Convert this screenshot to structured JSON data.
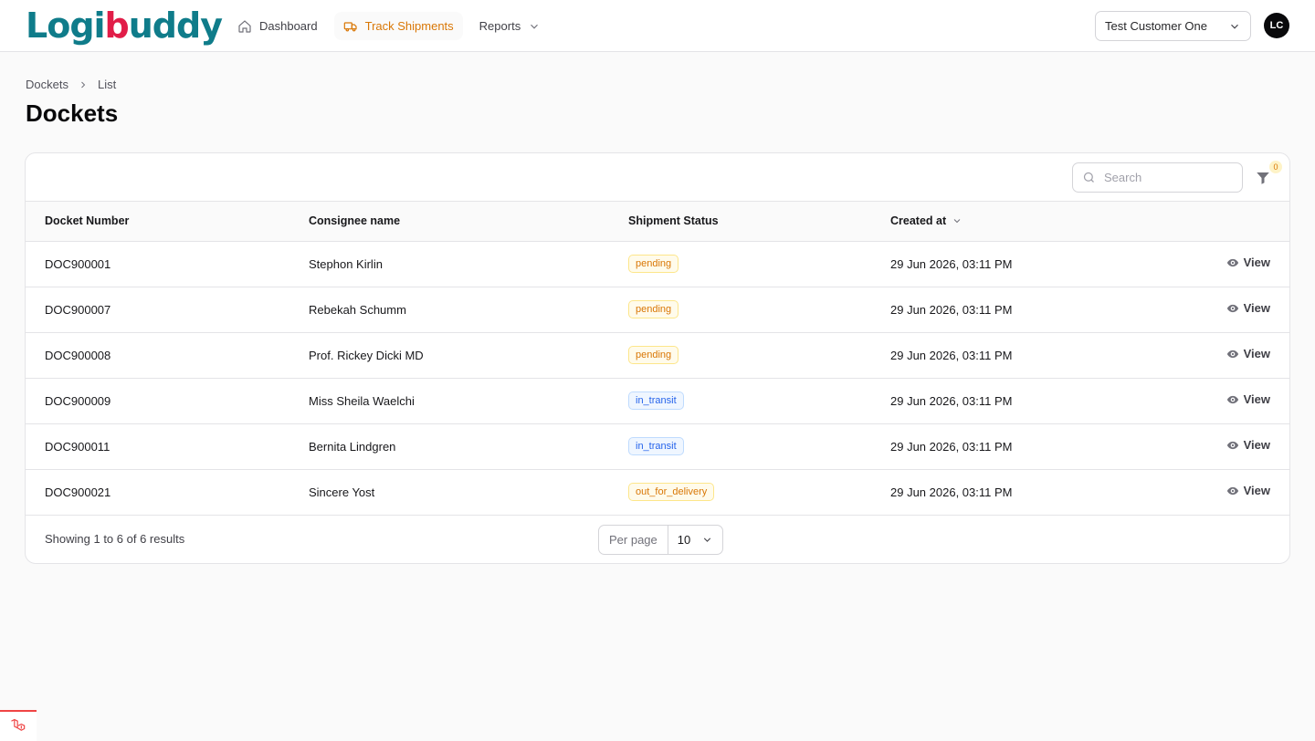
{
  "brand": {
    "name_part1": "Logi",
    "name_dot": "b",
    "name_part2": "uddy"
  },
  "nav": [
    {
      "label": "Dashboard",
      "icon": "home-icon"
    },
    {
      "label": "Track Shipments",
      "icon": "truck-icon",
      "active": true
    },
    {
      "label": "Reports",
      "icon": "chevron-down-icon"
    }
  ],
  "customer_select": {
    "value": "Test Customer One"
  },
  "user": {
    "initials": "LC"
  },
  "breadcrumb": {
    "parent": "Dockets",
    "current": "List"
  },
  "page_title": "Dockets",
  "search": {
    "placeholder": "Search"
  },
  "filter": {
    "count": "0"
  },
  "table": {
    "headers": {
      "docket_number": "Docket Number",
      "consignee_name": "Consignee name",
      "shipment_status": "Shipment Status",
      "created_at": "Created at"
    },
    "rows": [
      {
        "docket": "DOC900001",
        "consignee": "Stephon Kirlin",
        "status": "pending",
        "status_color": "warning",
        "created": "29 Jun 2026, 03:11 PM",
        "action": "View"
      },
      {
        "docket": "DOC900007",
        "consignee": "Rebekah Schumm",
        "status": "pending",
        "status_color": "warning",
        "created": "29 Jun 2026, 03:11 PM",
        "action": "View"
      },
      {
        "docket": "DOC900008",
        "consignee": "Prof. Rickey Dicki MD",
        "status": "pending",
        "status_color": "warning",
        "created": "29 Jun 2026, 03:11 PM",
        "action": "View"
      },
      {
        "docket": "DOC900009",
        "consignee": "Miss Sheila Waelchi",
        "status": "in_transit",
        "status_color": "info",
        "created": "29 Jun 2026, 03:11 PM",
        "action": "View"
      },
      {
        "docket": "DOC900011",
        "consignee": "Bernita Lindgren",
        "status": "in_transit",
        "status_color": "info",
        "created": "29 Jun 2026, 03:11 PM",
        "action": "View"
      },
      {
        "docket": "DOC900021",
        "consignee": "Sincere Yost",
        "status": "out_for_delivery",
        "status_color": "warning",
        "created": "29 Jun 2026, 03:11 PM",
        "action": "View"
      }
    ]
  },
  "pagination": {
    "results_text": "Showing 1 to 6 of 6 results",
    "per_page_label": "Per page",
    "per_page_value": "10"
  },
  "colors": {
    "accent": "#d97706",
    "brand": "#0f7c8a",
    "info": "#2563eb"
  }
}
